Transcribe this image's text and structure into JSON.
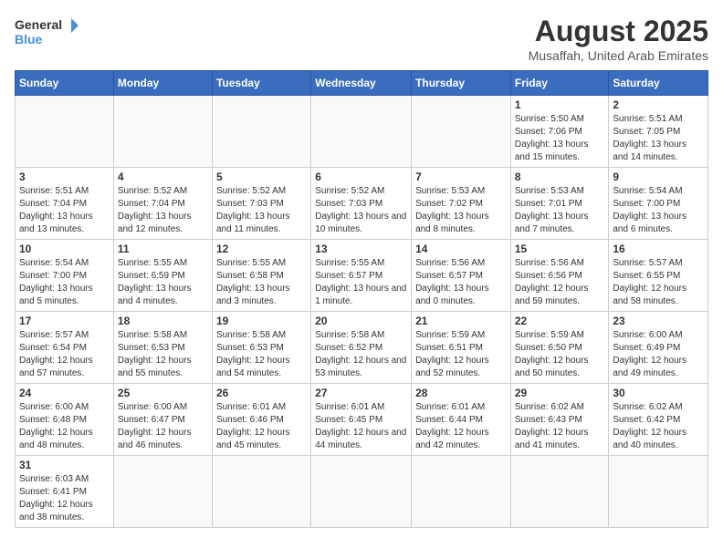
{
  "header": {
    "logo_text_general": "General",
    "logo_text_blue": "Blue",
    "title": "August 2025",
    "subtitle": "Musaffah, United Arab Emirates"
  },
  "days_of_week": [
    "Sunday",
    "Monday",
    "Tuesday",
    "Wednesday",
    "Thursday",
    "Friday",
    "Saturday"
  ],
  "weeks": [
    [
      {
        "day": "",
        "info": ""
      },
      {
        "day": "",
        "info": ""
      },
      {
        "day": "",
        "info": ""
      },
      {
        "day": "",
        "info": ""
      },
      {
        "day": "",
        "info": ""
      },
      {
        "day": "1",
        "info": "Sunrise: 5:50 AM\nSunset: 7:06 PM\nDaylight: 13 hours and 15 minutes."
      },
      {
        "day": "2",
        "info": "Sunrise: 5:51 AM\nSunset: 7:05 PM\nDaylight: 13 hours and 14 minutes."
      }
    ],
    [
      {
        "day": "3",
        "info": "Sunrise: 5:51 AM\nSunset: 7:04 PM\nDaylight: 13 hours and 13 minutes."
      },
      {
        "day": "4",
        "info": "Sunrise: 5:52 AM\nSunset: 7:04 PM\nDaylight: 13 hours and 12 minutes."
      },
      {
        "day": "5",
        "info": "Sunrise: 5:52 AM\nSunset: 7:03 PM\nDaylight: 13 hours and 11 minutes."
      },
      {
        "day": "6",
        "info": "Sunrise: 5:52 AM\nSunset: 7:03 PM\nDaylight: 13 hours and 10 minutes."
      },
      {
        "day": "7",
        "info": "Sunrise: 5:53 AM\nSunset: 7:02 PM\nDaylight: 13 hours and 8 minutes."
      },
      {
        "day": "8",
        "info": "Sunrise: 5:53 AM\nSunset: 7:01 PM\nDaylight: 13 hours and 7 minutes."
      },
      {
        "day": "9",
        "info": "Sunrise: 5:54 AM\nSunset: 7:00 PM\nDaylight: 13 hours and 6 minutes."
      }
    ],
    [
      {
        "day": "10",
        "info": "Sunrise: 5:54 AM\nSunset: 7:00 PM\nDaylight: 13 hours and 5 minutes."
      },
      {
        "day": "11",
        "info": "Sunrise: 5:55 AM\nSunset: 6:59 PM\nDaylight: 13 hours and 4 minutes."
      },
      {
        "day": "12",
        "info": "Sunrise: 5:55 AM\nSunset: 6:58 PM\nDaylight: 13 hours and 3 minutes."
      },
      {
        "day": "13",
        "info": "Sunrise: 5:55 AM\nSunset: 6:57 PM\nDaylight: 13 hours and 1 minute."
      },
      {
        "day": "14",
        "info": "Sunrise: 5:56 AM\nSunset: 6:57 PM\nDaylight: 13 hours and 0 minutes."
      },
      {
        "day": "15",
        "info": "Sunrise: 5:56 AM\nSunset: 6:56 PM\nDaylight: 12 hours and 59 minutes."
      },
      {
        "day": "16",
        "info": "Sunrise: 5:57 AM\nSunset: 6:55 PM\nDaylight: 12 hours and 58 minutes."
      }
    ],
    [
      {
        "day": "17",
        "info": "Sunrise: 5:57 AM\nSunset: 6:54 PM\nDaylight: 12 hours and 57 minutes."
      },
      {
        "day": "18",
        "info": "Sunrise: 5:58 AM\nSunset: 6:53 PM\nDaylight: 12 hours and 55 minutes."
      },
      {
        "day": "19",
        "info": "Sunrise: 5:58 AM\nSunset: 6:53 PM\nDaylight: 12 hours and 54 minutes."
      },
      {
        "day": "20",
        "info": "Sunrise: 5:58 AM\nSunset: 6:52 PM\nDaylight: 12 hours and 53 minutes."
      },
      {
        "day": "21",
        "info": "Sunrise: 5:59 AM\nSunset: 6:51 PM\nDaylight: 12 hours and 52 minutes."
      },
      {
        "day": "22",
        "info": "Sunrise: 5:59 AM\nSunset: 6:50 PM\nDaylight: 12 hours and 50 minutes."
      },
      {
        "day": "23",
        "info": "Sunrise: 6:00 AM\nSunset: 6:49 PM\nDaylight: 12 hours and 49 minutes."
      }
    ],
    [
      {
        "day": "24",
        "info": "Sunrise: 6:00 AM\nSunset: 6:48 PM\nDaylight: 12 hours and 48 minutes."
      },
      {
        "day": "25",
        "info": "Sunrise: 6:00 AM\nSunset: 6:47 PM\nDaylight: 12 hours and 46 minutes."
      },
      {
        "day": "26",
        "info": "Sunrise: 6:01 AM\nSunset: 6:46 PM\nDaylight: 12 hours and 45 minutes."
      },
      {
        "day": "27",
        "info": "Sunrise: 6:01 AM\nSunset: 6:45 PM\nDaylight: 12 hours and 44 minutes."
      },
      {
        "day": "28",
        "info": "Sunrise: 6:01 AM\nSunset: 6:44 PM\nDaylight: 12 hours and 42 minutes."
      },
      {
        "day": "29",
        "info": "Sunrise: 6:02 AM\nSunset: 6:43 PM\nDaylight: 12 hours and 41 minutes."
      },
      {
        "day": "30",
        "info": "Sunrise: 6:02 AM\nSunset: 6:42 PM\nDaylight: 12 hours and 40 minutes."
      }
    ],
    [
      {
        "day": "31",
        "info": "Sunrise: 6:03 AM\nSunset: 6:41 PM\nDaylight: 12 hours and 38 minutes."
      },
      {
        "day": "",
        "info": ""
      },
      {
        "day": "",
        "info": ""
      },
      {
        "day": "",
        "info": ""
      },
      {
        "day": "",
        "info": ""
      },
      {
        "day": "",
        "info": ""
      },
      {
        "day": "",
        "info": ""
      }
    ]
  ]
}
